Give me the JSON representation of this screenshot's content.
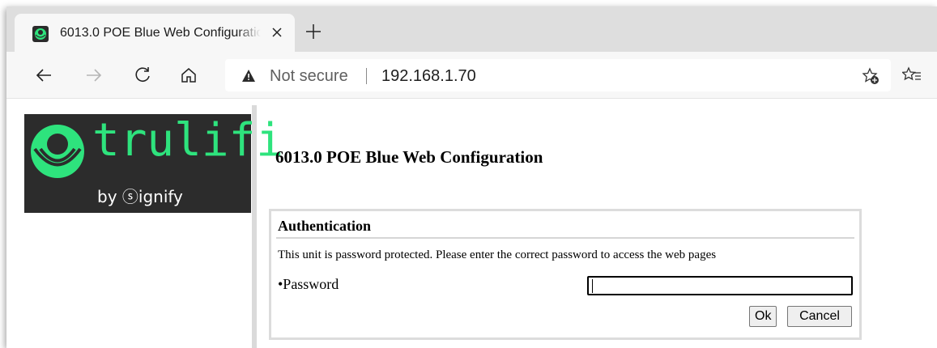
{
  "browser": {
    "tab_title": "6013.0 POE Blue Web Configuration",
    "security_label": "Not secure",
    "url": "192.168.1.70",
    "icons": [
      "back-icon",
      "forward-icon",
      "refresh-icon",
      "home-icon",
      "warning-icon",
      "add-favorite-icon",
      "favorites-icon",
      "close-icon",
      "new-tab-icon"
    ]
  },
  "logo": {
    "wordmark": "trulifi",
    "byline": "by ⓢignify",
    "colors": {
      "background": "#2c2c2c",
      "accent": "#2ee37d"
    }
  },
  "page": {
    "title": "6013.0 POE Blue Web Configuration"
  },
  "auth": {
    "heading": "Authentication",
    "message": "This unit is password protected. Please enter the correct password to access the web pages",
    "password_label": "•Password",
    "password_value": "",
    "ok_label": "Ok",
    "cancel_label": "Cancel"
  }
}
